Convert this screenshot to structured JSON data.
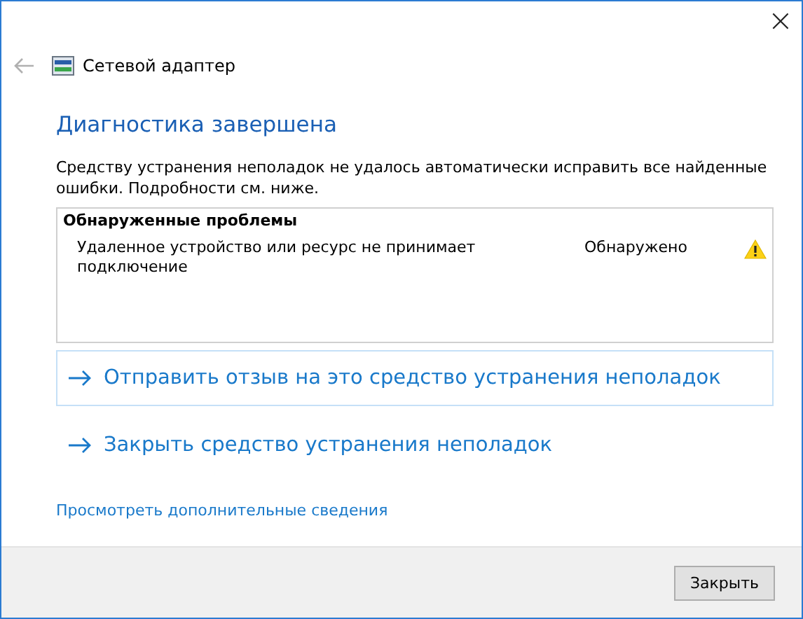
{
  "window": {
    "title": "Сетевой адаптер",
    "close": "×"
  },
  "heading": "Диагностика завершена",
  "message": "Средству устранения неполадок не удалось автоматически исправить все найденные ошибки. Подробности см. ниже.",
  "problems": {
    "title": "Обнаруженные проблемы",
    "items": [
      {
        "description": "Удаленное устройство или ресурс не принимает подключение",
        "status": "Обнаружено",
        "kind": "warning"
      }
    ]
  },
  "actions": [
    {
      "label": "Отправить отзыв на это средство устранения неполадок",
      "focused": true
    },
    {
      "label": "Закрыть средство устранения неполадок",
      "focused": false
    }
  ],
  "more_info": "Просмотреть дополнительные сведения",
  "buttons": [
    "Закрыть"
  ]
}
